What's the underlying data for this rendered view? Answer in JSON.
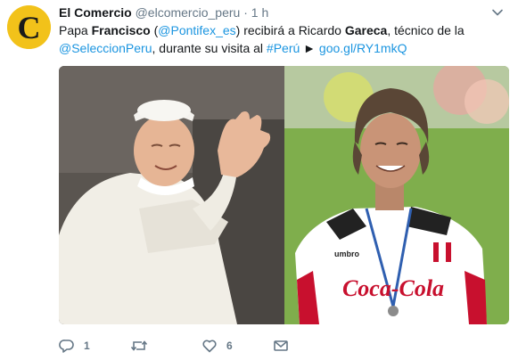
{
  "account": {
    "name": "El Comercio",
    "handle": "@elcomercio_peru",
    "separator": "·",
    "time": "1 h",
    "avatar_letter": "C",
    "avatar_color": "#f2c21a"
  },
  "tweet": {
    "t1": "Papa ",
    "t2": "Francisco",
    "t3": " (",
    "t4": "@Pontifex_es",
    "t5": ") recibirá a Ricardo ",
    "t6": "Gareca",
    "t7": ", técnico de la ",
    "t8": "@SeleccionPeru",
    "t9": ", durante su visita al ",
    "t10": "#Perú",
    "t11": " ► ",
    "t12": "goo.gl/RY1mkQ"
  },
  "media": {
    "shirt_brand": "Coca-Cola",
    "shirt_maker": "umbro"
  },
  "actions": {
    "reply_count": "1",
    "retweet_count": "",
    "like_count": "6"
  },
  "colors": {
    "link": "#1b95e0",
    "muted": "#657786"
  },
  "icons": [
    "caret-down-icon",
    "reply-icon",
    "retweet-icon",
    "like-icon",
    "message-icon"
  ]
}
